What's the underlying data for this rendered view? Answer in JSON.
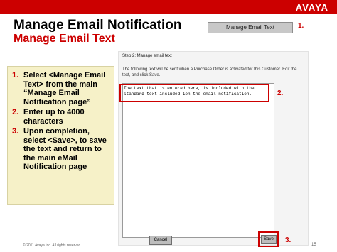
{
  "brand": {
    "logo": "AVAYA",
    "bar_color": "#cc0000"
  },
  "header": {
    "title": "Manage Email Notification",
    "subtitle": "Manage Email Text",
    "button_label": "Manage Email Text",
    "callout": "1."
  },
  "steps": [
    {
      "num": "1.",
      "text": "Select <Manage Email Text> from the main “Manage Email Notification page”"
    },
    {
      "num": "2.",
      "text": "Enter up to 4000 characters"
    },
    {
      "num": "3.",
      "text": "Upon completion, select <Save>, to save the text and return to the main eMail Notification page"
    }
  ],
  "form": {
    "step_label": "Step 2: Manage email text",
    "instructions": "The following text will be sent when a Purchase Order is activated for this Customer. Edit the text, and click Save.",
    "textarea_value": "The text that is entered here, is included with the\nstandard text included ion the email notification.",
    "callout": "2.",
    "cancel_label": "Cancel",
    "save_label": "Save",
    "save_callout": "3."
  },
  "footer": {
    "copyright": "© 2011 Avaya Inc. All rights reserved.",
    "page": "15"
  }
}
